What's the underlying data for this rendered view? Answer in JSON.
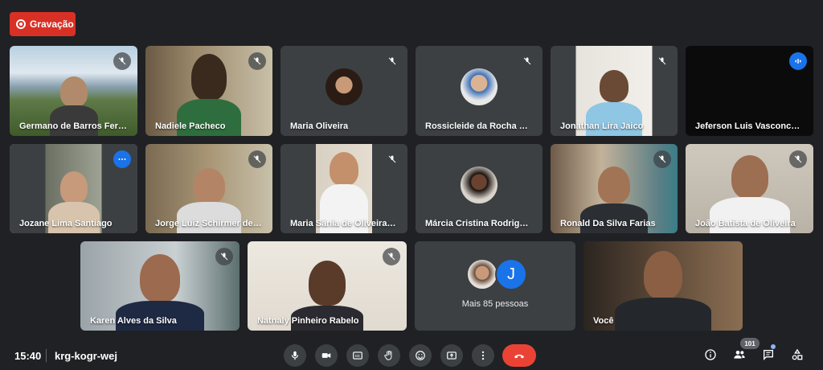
{
  "recording": {
    "label": "Gravação"
  },
  "tiles": [
    {
      "name": "Germano de Barros Ferre..."
    },
    {
      "name": "Nadiele Pacheco"
    },
    {
      "name": "Maria Oliveira"
    },
    {
      "name": "Rossicleide da Rocha Bati..."
    },
    {
      "name": "Jonathan Lira Jaico"
    },
    {
      "name": "Jeferson Luis Vasconcelo..."
    },
    {
      "name": "Jozane Lima Santiago"
    },
    {
      "name": "Jorge Luiz Schirmer de M..."
    },
    {
      "name": "Maria Sânia de Oliveira Fr..."
    },
    {
      "name": "Márcia Cristina Rodrigue..."
    },
    {
      "name": "Ronald Da Silva Farias"
    },
    {
      "name": "João Batista de Oliveira"
    },
    {
      "name": "Karen Alves da Silva"
    },
    {
      "name": "Natnaly Pinheiro Rabelo"
    },
    {
      "name": "Você"
    }
  ],
  "more_people": {
    "label": "Mais 85 pessoas",
    "avatar_letter": "J"
  },
  "bottom": {
    "time": "15:40",
    "meeting_code": "krg-kogr-wej",
    "participants_count": "101"
  },
  "colors": {
    "background": "#202124",
    "tile": "#3c4043",
    "accent": "#1a73e8",
    "hangup": "#ea4335",
    "recording": "#d93025"
  }
}
